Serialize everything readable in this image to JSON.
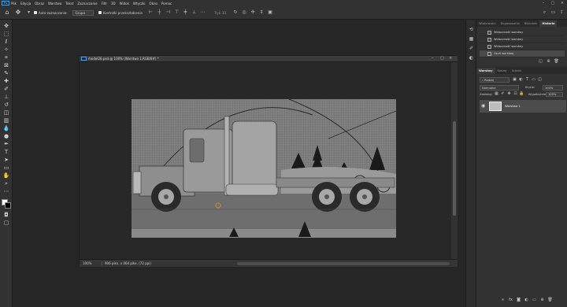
{
  "menu": {
    "logo": "Ps",
    "items": [
      "Plik",
      "Edycja",
      "Obraz",
      "Warstwa",
      "Tekst",
      "Zaznaczanie",
      "Filtr",
      "3D",
      "Widok",
      "Wtyczki",
      "Okno",
      "Pomoc"
    ]
  },
  "options_bar": {
    "auto_select_label": "Auto-zaznaczanie:",
    "auto_select_value": "Grupa",
    "transform_controls_label": "Kontrolki przekształcenia",
    "mode_3d_label": "Tryb 3D:"
  },
  "document": {
    "tab_title": "model26.psd @ 100% (Warstwa 1,RGB/8#) *",
    "zoom": "100%",
    "info": "906 pikx. x 464 pikx. (72 ppi)"
  },
  "panels": {
    "top_tabs": [
      "Właściwości",
      "Dopasowania",
      "Biblioteki",
      "Historia"
    ],
    "active_top_tab": "Historia",
    "history_items": [
      "Widoczność warstwy",
      "Widoczność warstwy",
      "Widoczność warstwy",
      "Usuń warstwę"
    ],
    "layer_tabs": [
      "Warstwy",
      "Kanały",
      "Ścieżki"
    ],
    "active_layer_tab": "Warstwy",
    "kind_label": "Rodzaj",
    "blend_mode": "Normalne",
    "opacity_label": "Krycie:",
    "opacity_value": "100%",
    "lock_label": "Zablokuj:",
    "fill_label": "Wypełnienie:",
    "fill_value": "100%",
    "layer_name": "Warstwa 1"
  },
  "colors": {
    "accent": "#31a8ff",
    "panel_bg": "#323232",
    "workspace_bg": "#262626"
  }
}
